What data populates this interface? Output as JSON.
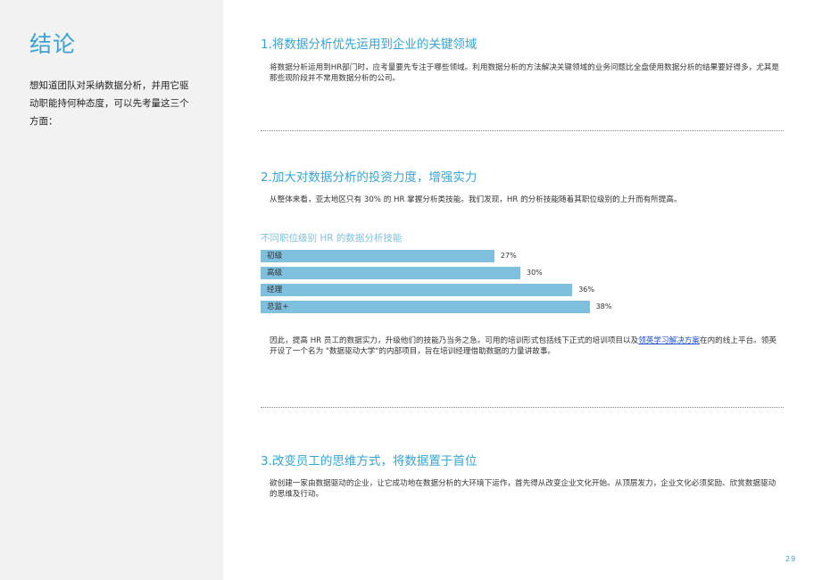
{
  "sidebar": {
    "title": "结论",
    "intro": "想知道团队对采纳数据分析，并用它驱动职能持何种态度，可以先考量这三个方面："
  },
  "section1": {
    "heading": "1.将数据分析优先运用到企业的关键领域",
    "body": "将数据分析运用到HR部门时，应考量要先专注于哪些领域。利用数据分析的方法解决关键领域的业务问题比全盘使用数据分析的结果要好得多，尤其是那些现阶段并不常用数据分析的公司。"
  },
  "section2": {
    "heading": "2.加大对数据分析的投资力度，增强实力",
    "body": "从整体来看，亚太地区只有 30% 的 HR 掌握分析类技能。我们发现，HR 的分析技能随着其职位级别的上升而有所提高。",
    "body2_before": "因此，提高 HR 员工的数据实力，升级他们的技能乃当务之急。可用的培训形式包括线下正式的培训项目以及",
    "body2_link": "领英学习解决方案",
    "body2_after": "在内的线上平台。领英开设了一个名为 \"数据驱动大学\"的内部项目，旨在培训经理借助数据的力量讲故事。"
  },
  "chart_data": {
    "type": "bar",
    "orientation": "horizontal",
    "title": "不同职位级别 HR 的数据分析技能",
    "categories": [
      "初级",
      "高级",
      "经理",
      "总监+"
    ],
    "values": [
      27,
      30,
      36,
      38
    ],
    "value_labels": [
      "27%",
      "30%",
      "36%",
      "38%"
    ],
    "unit": "%",
    "color": "#7fc0df"
  },
  "section3": {
    "heading": "3.改变员工的思维方式，将数据置于首位",
    "body": "欲创建一家由数据驱动的企业，让它成功地在数据分析的大环境下运作，首先得从改变企业文化开始。从顶层发力，企业文化必须奖励、欣赏数据驱动的思维及行动。"
  },
  "page_number": "29",
  "colors": {
    "accent": "#3aa3d0",
    "bar": "#7fc0df",
    "sidebar_bg": "#f2f2f2",
    "link": "#1f4fc8"
  }
}
